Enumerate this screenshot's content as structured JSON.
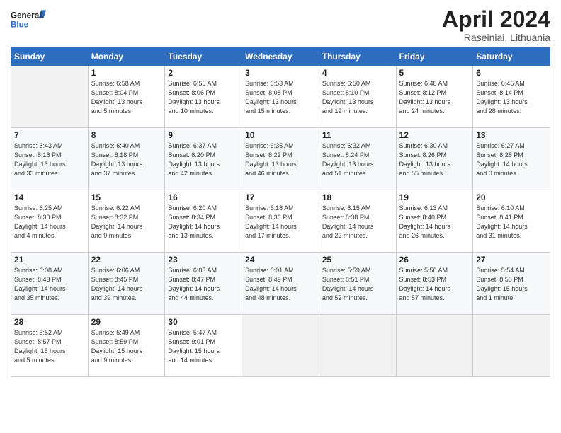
{
  "header": {
    "logo_general": "General",
    "logo_blue": "Blue",
    "title": "April 2024",
    "subtitle": "Raseiniai, Lithuania"
  },
  "weekdays": [
    "Sunday",
    "Monday",
    "Tuesday",
    "Wednesday",
    "Thursday",
    "Friday",
    "Saturday"
  ],
  "weeks": [
    [
      {
        "day": "",
        "info": ""
      },
      {
        "day": "1",
        "info": "Sunrise: 6:58 AM\nSunset: 8:04 PM\nDaylight: 13 hours\nand 5 minutes."
      },
      {
        "day": "2",
        "info": "Sunrise: 6:55 AM\nSunset: 8:06 PM\nDaylight: 13 hours\nand 10 minutes."
      },
      {
        "day": "3",
        "info": "Sunrise: 6:53 AM\nSunset: 8:08 PM\nDaylight: 13 hours\nand 15 minutes."
      },
      {
        "day": "4",
        "info": "Sunrise: 6:50 AM\nSunset: 8:10 PM\nDaylight: 13 hours\nand 19 minutes."
      },
      {
        "day": "5",
        "info": "Sunrise: 6:48 AM\nSunset: 8:12 PM\nDaylight: 13 hours\nand 24 minutes."
      },
      {
        "day": "6",
        "info": "Sunrise: 6:45 AM\nSunset: 8:14 PM\nDaylight: 13 hours\nand 28 minutes."
      }
    ],
    [
      {
        "day": "7",
        "info": "Sunrise: 6:43 AM\nSunset: 8:16 PM\nDaylight: 13 hours\nand 33 minutes."
      },
      {
        "day": "8",
        "info": "Sunrise: 6:40 AM\nSunset: 8:18 PM\nDaylight: 13 hours\nand 37 minutes."
      },
      {
        "day": "9",
        "info": "Sunrise: 6:37 AM\nSunset: 8:20 PM\nDaylight: 13 hours\nand 42 minutes."
      },
      {
        "day": "10",
        "info": "Sunrise: 6:35 AM\nSunset: 8:22 PM\nDaylight: 13 hours\nand 46 minutes."
      },
      {
        "day": "11",
        "info": "Sunrise: 6:32 AM\nSunset: 8:24 PM\nDaylight: 13 hours\nand 51 minutes."
      },
      {
        "day": "12",
        "info": "Sunrise: 6:30 AM\nSunset: 8:26 PM\nDaylight: 13 hours\nand 55 minutes."
      },
      {
        "day": "13",
        "info": "Sunrise: 6:27 AM\nSunset: 8:28 PM\nDaylight: 14 hours\nand 0 minutes."
      }
    ],
    [
      {
        "day": "14",
        "info": "Sunrise: 6:25 AM\nSunset: 8:30 PM\nDaylight: 14 hours\nand 4 minutes."
      },
      {
        "day": "15",
        "info": "Sunrise: 6:22 AM\nSunset: 8:32 PM\nDaylight: 14 hours\nand 9 minutes."
      },
      {
        "day": "16",
        "info": "Sunrise: 6:20 AM\nSunset: 8:34 PM\nDaylight: 14 hours\nand 13 minutes."
      },
      {
        "day": "17",
        "info": "Sunrise: 6:18 AM\nSunset: 8:36 PM\nDaylight: 14 hours\nand 17 minutes."
      },
      {
        "day": "18",
        "info": "Sunrise: 6:15 AM\nSunset: 8:38 PM\nDaylight: 14 hours\nand 22 minutes."
      },
      {
        "day": "19",
        "info": "Sunrise: 6:13 AM\nSunset: 8:40 PM\nDaylight: 14 hours\nand 26 minutes."
      },
      {
        "day": "20",
        "info": "Sunrise: 6:10 AM\nSunset: 8:41 PM\nDaylight: 14 hours\nand 31 minutes."
      }
    ],
    [
      {
        "day": "21",
        "info": "Sunrise: 6:08 AM\nSunset: 8:43 PM\nDaylight: 14 hours\nand 35 minutes."
      },
      {
        "day": "22",
        "info": "Sunrise: 6:06 AM\nSunset: 8:45 PM\nDaylight: 14 hours\nand 39 minutes."
      },
      {
        "day": "23",
        "info": "Sunrise: 6:03 AM\nSunset: 8:47 PM\nDaylight: 14 hours\nand 44 minutes."
      },
      {
        "day": "24",
        "info": "Sunrise: 6:01 AM\nSunset: 8:49 PM\nDaylight: 14 hours\nand 48 minutes."
      },
      {
        "day": "25",
        "info": "Sunrise: 5:59 AM\nSunset: 8:51 PM\nDaylight: 14 hours\nand 52 minutes."
      },
      {
        "day": "26",
        "info": "Sunrise: 5:56 AM\nSunset: 8:53 PM\nDaylight: 14 hours\nand 57 minutes."
      },
      {
        "day": "27",
        "info": "Sunrise: 5:54 AM\nSunset: 8:55 PM\nDaylight: 15 hours\nand 1 minute."
      }
    ],
    [
      {
        "day": "28",
        "info": "Sunrise: 5:52 AM\nSunset: 8:57 PM\nDaylight: 15 hours\nand 5 minutes."
      },
      {
        "day": "29",
        "info": "Sunrise: 5:49 AM\nSunset: 8:59 PM\nDaylight: 15 hours\nand 9 minutes."
      },
      {
        "day": "30",
        "info": "Sunrise: 5:47 AM\nSunset: 9:01 PM\nDaylight: 15 hours\nand 14 minutes."
      },
      {
        "day": "",
        "info": ""
      },
      {
        "day": "",
        "info": ""
      },
      {
        "day": "",
        "info": ""
      },
      {
        "day": "",
        "info": ""
      }
    ]
  ]
}
